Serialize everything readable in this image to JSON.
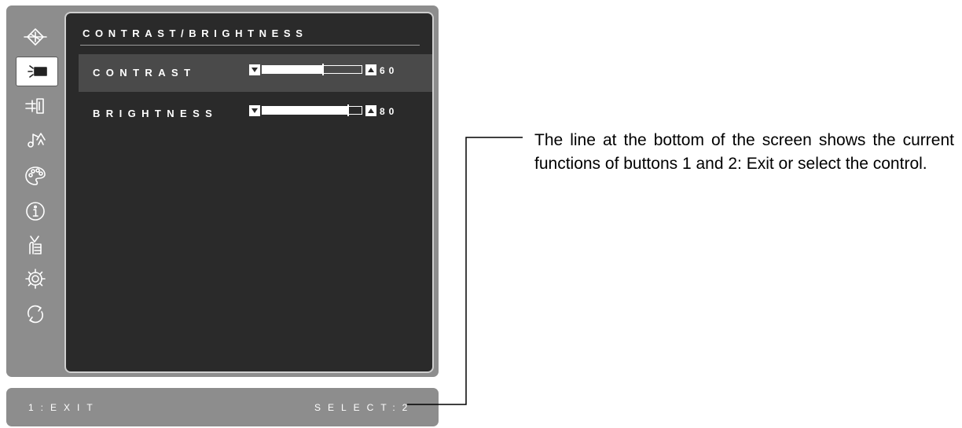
{
  "osd": {
    "menu_title": "CONTRAST/BRIGHTNESS",
    "sidebar_icons": [
      {
        "name": "auto-image-adjust-icon",
        "active": false
      },
      {
        "name": "contrast-brightness-icon",
        "active": true
      },
      {
        "name": "input-select-icon",
        "active": false
      },
      {
        "name": "audio-adjust-icon",
        "active": false
      },
      {
        "name": "color-adjust-icon",
        "active": false
      },
      {
        "name": "information-icon",
        "active": false
      },
      {
        "name": "manual-image-adjust-icon",
        "active": false
      },
      {
        "name": "setup-menu-icon",
        "active": false
      },
      {
        "name": "memory-recall-icon",
        "active": false
      }
    ],
    "controls": [
      {
        "label": "CONTRAST",
        "value": "60",
        "level": 0.6
      },
      {
        "label": "BRIGHTNESS",
        "value": "80",
        "level": 0.86
      }
    ]
  },
  "statusbar": {
    "button1": "1:EXIT",
    "button2": "SELECT:2"
  },
  "callout": {
    "text": "The line at the bottom of the screen shows the current functions of buttons 1 and 2: Exit or select the control."
  },
  "colors": {
    "panel": "#8d8d8d",
    "content_bg": "#2a2a2a",
    "highlight_row": "#4a4a4a",
    "text": "#ffffff"
  }
}
